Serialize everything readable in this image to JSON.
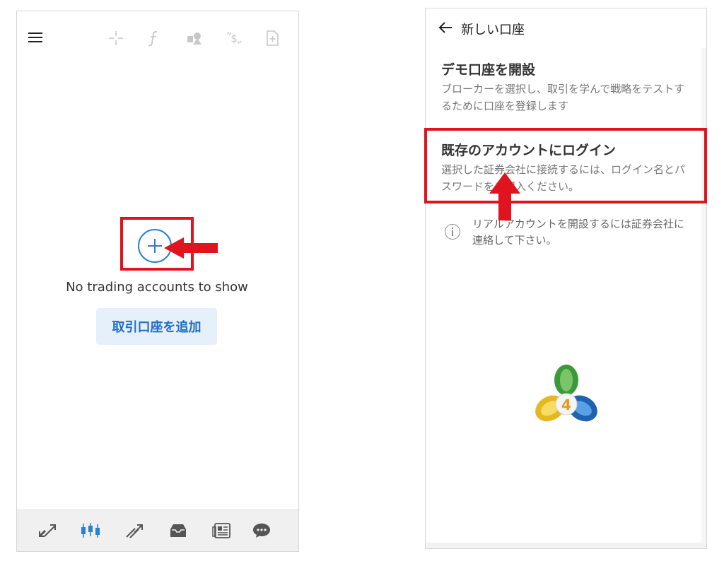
{
  "left_screen": {
    "toolbar_icons": [
      "menu-icon",
      "crosshair-icon",
      "function-icon",
      "objects-icon",
      "currency-icon",
      "add-file-icon"
    ],
    "empty_message": "No trading accounts to show",
    "add_account_button": "取引口座を追加",
    "bottom_nav": [
      "quotes-icon",
      "chart-candles-icon",
      "trade-icon",
      "mailbox-icon",
      "news-icon",
      "chat-icon"
    ],
    "accent_color": "#2b7fd4"
  },
  "right_screen": {
    "header": {
      "back_icon": "arrow-left-icon",
      "title": "新しい口座"
    },
    "options": [
      {
        "title": "デモ口座を開設",
        "description": "ブローカーを選択し、取引を学んで戦略をテストするために口座を登録します"
      },
      {
        "title": "既存のアカウントにログイン",
        "description": "選択した証券会社に接続するには、ログイン名とパスワードをご記入ください。"
      }
    ],
    "info": {
      "icon": "info-icon",
      "text": "リアルアカウントを開設するには証券会社に連絡して下さい。"
    },
    "logo": {
      "name": "metatrader-4-logo",
      "badge": "4"
    }
  },
  "annotation_color": "#e0141e"
}
